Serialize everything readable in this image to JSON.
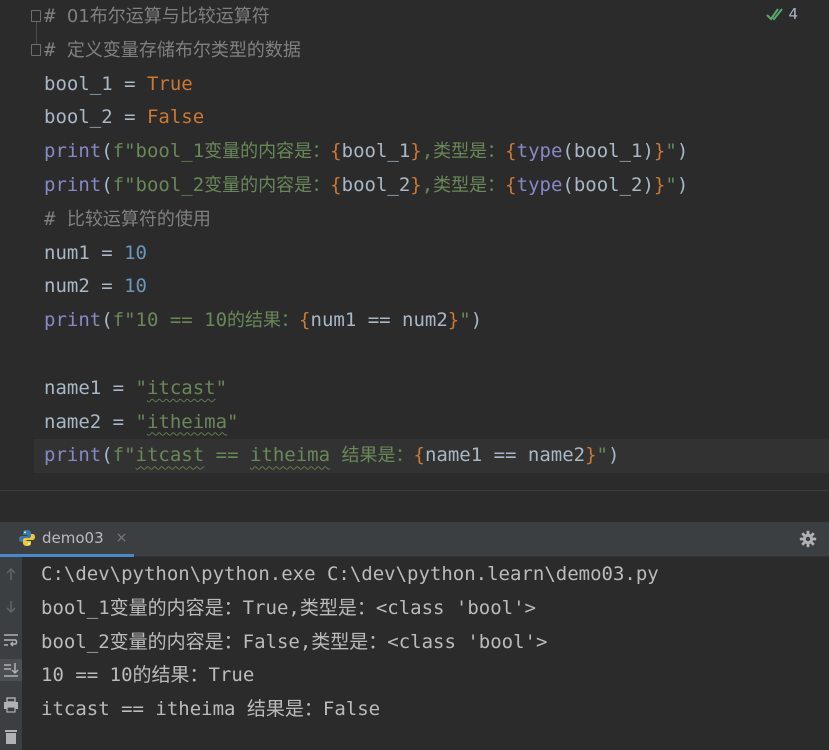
{
  "editor": {
    "inspection_count": "4",
    "lines": [
      {
        "segments": [
          {
            "t": "# ",
            "c": "cmt"
          },
          {
            "t": "01布尔运算与比较运算符",
            "c": "cmt cn"
          }
        ]
      },
      {
        "segments": [
          {
            "t": "# ",
            "c": "cmt"
          },
          {
            "t": "定义变量存储布尔类型的数据",
            "c": "cmt cn"
          }
        ]
      },
      {
        "segments": [
          {
            "t": "bool_1 = ",
            "c": ""
          },
          {
            "t": "True",
            "c": "kw"
          }
        ]
      },
      {
        "segments": [
          {
            "t": "bool_2 = ",
            "c": ""
          },
          {
            "t": "False",
            "c": "kw"
          }
        ]
      },
      {
        "segments": [
          {
            "t": "print",
            "c": "fn"
          },
          {
            "t": "(",
            "c": ""
          },
          {
            "t": "f\"bool_1",
            "c": "str"
          },
          {
            "t": "变量的内容是：",
            "c": "str cn"
          },
          {
            "t": "{",
            "c": "brace"
          },
          {
            "t": "bool_1",
            "c": ""
          },
          {
            "t": "}",
            "c": "brace"
          },
          {
            "t": ",",
            "c": "str"
          },
          {
            "t": "类型是：",
            "c": "str cn"
          },
          {
            "t": "{",
            "c": "brace"
          },
          {
            "t": "type",
            "c": "fn"
          },
          {
            "t": "(bool_1)",
            "c": ""
          },
          {
            "t": "}",
            "c": "brace"
          },
          {
            "t": "\"",
            "c": "str"
          },
          {
            "t": ")",
            "c": ""
          }
        ]
      },
      {
        "segments": [
          {
            "t": "print",
            "c": "fn"
          },
          {
            "t": "(",
            "c": ""
          },
          {
            "t": "f\"bool_2",
            "c": "str"
          },
          {
            "t": "变量的内容是：",
            "c": "str cn"
          },
          {
            "t": "{",
            "c": "brace"
          },
          {
            "t": "bool_2",
            "c": ""
          },
          {
            "t": "}",
            "c": "brace"
          },
          {
            "t": ",",
            "c": "str"
          },
          {
            "t": "类型是：",
            "c": "str cn"
          },
          {
            "t": "{",
            "c": "brace"
          },
          {
            "t": "type",
            "c": "fn"
          },
          {
            "t": "(bool_2)",
            "c": ""
          },
          {
            "t": "}",
            "c": "brace"
          },
          {
            "t": "\"",
            "c": "str"
          },
          {
            "t": ")",
            "c": ""
          }
        ]
      },
      {
        "segments": [
          {
            "t": "# ",
            "c": "cmt"
          },
          {
            "t": "比较运算符的使用",
            "c": "cmt cn"
          }
        ]
      },
      {
        "segments": [
          {
            "t": "num1 = ",
            "c": ""
          },
          {
            "t": "10",
            "c": "num"
          }
        ]
      },
      {
        "segments": [
          {
            "t": "num2 = ",
            "c": ""
          },
          {
            "t": "10",
            "c": "num"
          }
        ]
      },
      {
        "segments": [
          {
            "t": "print",
            "c": "fn"
          },
          {
            "t": "(",
            "c": ""
          },
          {
            "t": "f\"10 == 10",
            "c": "str"
          },
          {
            "t": "的结果：",
            "c": "str cn"
          },
          {
            "t": "{",
            "c": "brace"
          },
          {
            "t": "num1 == num2",
            "c": ""
          },
          {
            "t": "}",
            "c": "brace"
          },
          {
            "t": "\"",
            "c": "str"
          },
          {
            "t": ")",
            "c": ""
          }
        ]
      },
      {
        "segments": []
      },
      {
        "segments": [
          {
            "t": "name1 = ",
            "c": ""
          },
          {
            "t": "\"",
            "c": "str"
          },
          {
            "t": "itcast",
            "c": "str typo"
          },
          {
            "t": "\"",
            "c": "str"
          }
        ]
      },
      {
        "segments": [
          {
            "t": "name2 = ",
            "c": ""
          },
          {
            "t": "\"",
            "c": "str"
          },
          {
            "t": "itheima",
            "c": "str typo"
          },
          {
            "t": "\"",
            "c": "str"
          }
        ]
      },
      {
        "segments": [
          {
            "t": "print",
            "c": "fn"
          },
          {
            "t": "(",
            "c": ""
          },
          {
            "t": "f\"",
            "c": "str"
          },
          {
            "t": "itcast",
            "c": "str typo"
          },
          {
            "t": " == ",
            "c": "str"
          },
          {
            "t": "itheima",
            "c": "str typo"
          },
          {
            "t": " ",
            "c": "str"
          },
          {
            "t": "结果是：",
            "c": "str cn"
          },
          {
            "t": "{",
            "c": "brace"
          },
          {
            "t": "name1 == name2",
            "c": ""
          },
          {
            "t": "}",
            "c": "brace"
          },
          {
            "t": "\"",
            "c": "str"
          },
          {
            "t": ")",
            "c": ""
          }
        ],
        "current": true
      }
    ]
  },
  "run": {
    "tab_label": "demo03",
    "tab_close": "×",
    "output": [
      "C:\\dev\\python\\python.exe C:\\dev\\python.learn\\demo03.py",
      "bool_1变量的内容是：True,类型是：<class 'bool'>",
      "bool_2变量的内容是：False,类型是：<class 'bool'>",
      "10 == 10的结果：True",
      "itcast == itheima 结果是：False"
    ]
  },
  "colors": {
    "editor_bg": "#2b2b2b",
    "panel_bg": "#3c3f41",
    "keyword": "#cc7832",
    "number": "#6897bb",
    "string": "#6a8759",
    "builtin": "#8888c6",
    "comment": "#808080",
    "tab_underline": "#4a88c7"
  }
}
